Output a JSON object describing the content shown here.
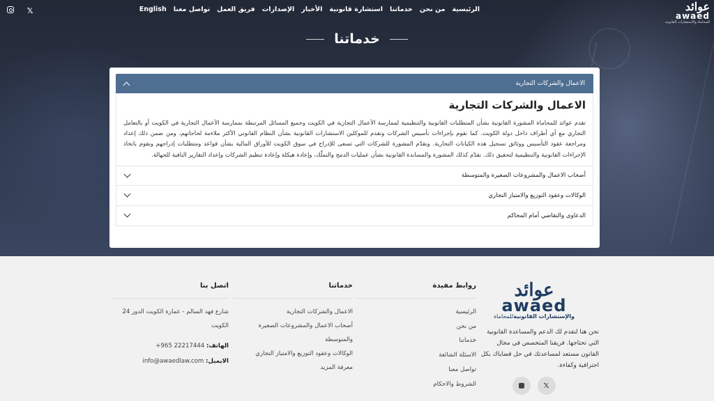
{
  "nav": {
    "links": [
      "الرئيسية",
      "من نحن",
      "خدماتنا",
      "استشارة قانونية",
      "الأخبار",
      "الإصدارات",
      "فريق العمل",
      "تواصل معنا",
      "English"
    ],
    "social_icons": [
      "instagram-icon",
      "x-icon"
    ]
  },
  "logo": {
    "ar": "عوائد",
    "en": "awaed",
    "sub": "للمحاماة والاستشارات القانونية"
  },
  "page": {
    "title": "خدماتنا"
  },
  "accordion": {
    "active": {
      "header": "الاعمال والشركات التجارية",
      "heading": "الاعمال والشركات التجارية",
      "body": "تقدم عوائد للمحاماة المشورة القانونية بشأن المتطلبات القانونية والتنظيمية لممارسة الأعمال التجارية في الكويت وجميع المسائل المرتبطة بممارسة الأعمال التجارية في الكويت أو بالتعامل التجاري مع أي أطراف داخل دولة الكويت. كما نقوم بإجراءات تأسيس الشركات ونقدم للموكلين الاستشارات القانونية بشأن النظام القانوني الأكثر ملاءمة لحاجاتهم، ومن ضمن ذلك إعداد ومراجعة عقود التأسيس ووثائق تسجيل هذه الكيانات التجارية. ونقدّم المشورة للشركات التي تسعى للإدراج في سوق الكويت للأوراق المالية بشأن قواعد ومتطلبات إدراجهم ونقوم باتخاذ الإجراءات القانونية والتنظيمية لتحقيق ذلك. نقدّم كذلك المشورة والمساندة القانونية بشأن عمليات الدمج والتملّك، وإعادة هيكلة وإعادة تنظيم الشركات وإعداد التقارير النافية للجهالة."
    },
    "items": [
      "أصحاب الاعمال والمشروعات الصغيرة والمتوسطة",
      "الوكالات وعقود التوزيع والامتياز التجاري",
      "الدعاوى والتقاضي أمام المحاكم"
    ]
  },
  "footer": {
    "brand_text": "نحن هنا لنقدم لك الدعم والمساعدة القانونية التي تحتاجها. فريقنا المتخصص في مجال القانون مستعد لمساعدتك في حل قضاياك بكل احترافية وكفاءة.",
    "logo_sub_prefix": "للمحاماة ",
    "logo_sub_bold": "والإستشارات القانونية",
    "useful_links": {
      "title": "روابط مفيدة",
      "items": [
        "الرئيسية",
        "من نحن",
        "خدماتنا",
        "الاسئلة الشائعة",
        "تواصل معنا",
        "الشروط والاحكام"
      ]
    },
    "services": {
      "title": "خدماتنا",
      "items": [
        "الاعمال والشركات التجارية",
        "أصحاب الاعمال والمشروعات الصغيرة والمتوسطة",
        "الوكالات وعقود التوزيع والامتياز التجاري",
        "معرفة المزيد"
      ]
    },
    "contact": {
      "title": "اتصل بنا",
      "address": "شارع فهد السالم - عمارة الكويت الدور 24 الكويت",
      "phone_label": "الهاتف:",
      "phone": "+965 22217444",
      "email_label": "الايميل:",
      "email": "info@awaedlaw.com"
    },
    "social_icons": [
      "x-icon",
      "instagram-icon"
    ]
  }
}
